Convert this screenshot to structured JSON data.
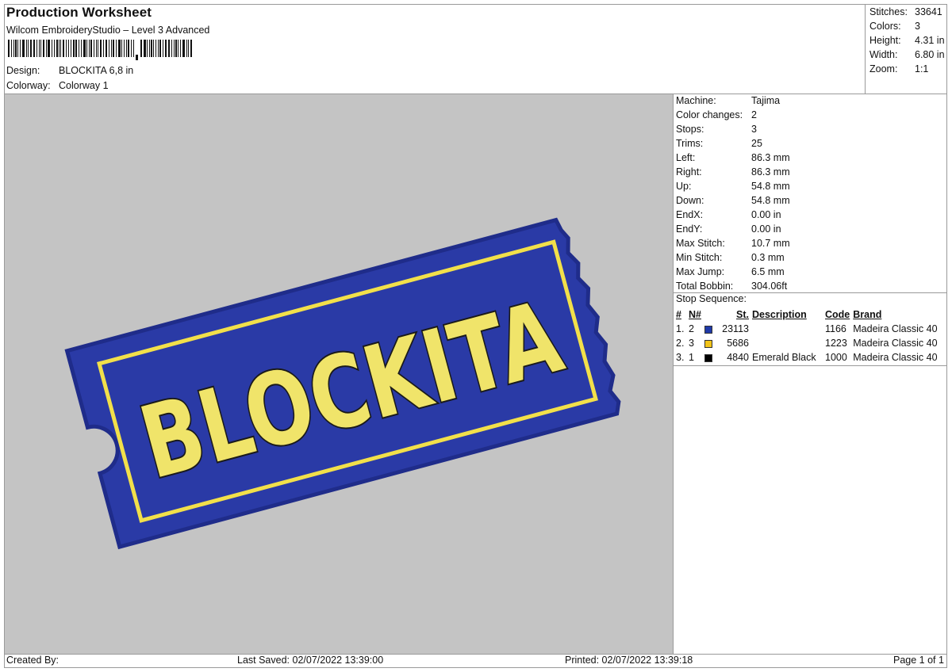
{
  "header": {
    "title": "Production Worksheet",
    "software": "Wilcom EmbroideryStudio – Level 3 Advanced",
    "design_label": "Design:",
    "design_value": "BLOCKITA 6,8 in",
    "colorway_label": "Colorway:",
    "colorway_value": "Colorway 1"
  },
  "summary": [
    {
      "label": "Stitches:",
      "value": "33641"
    },
    {
      "label": "Colors:",
      "value": "3"
    },
    {
      "label": "Height:",
      "value": "4.31 in"
    },
    {
      "label": "Width:",
      "value": "6.80 in"
    },
    {
      "label": "Zoom:",
      "value": "1:1"
    }
  ],
  "design_preview": {
    "text": "BLOCKITA",
    "colors": {
      "body": "#2a3aa6",
      "border": "#1f2c8a",
      "outline": "#f2e04a",
      "lettering": "#f0e46a",
      "letter_outline": "#1a1a1a"
    }
  },
  "machine_info": [
    {
      "label": "Machine:",
      "value": "Tajima"
    },
    {
      "label": "Color changes:",
      "value": "2"
    },
    {
      "label": "Stops:",
      "value": "3"
    },
    {
      "label": "Trims:",
      "value": "25"
    },
    {
      "label": "Left:",
      "value": "86.3 mm"
    },
    {
      "label": "Right:",
      "value": "86.3 mm"
    },
    {
      "label": "Up:",
      "value": "54.8 mm"
    },
    {
      "label": "Down:",
      "value": "54.8 mm"
    },
    {
      "label": "EndX:",
      "value": "0.00 in"
    },
    {
      "label": "EndY:",
      "value": "0.00 in"
    },
    {
      "label": "Max Stitch:",
      "value": "10.7 mm"
    },
    {
      "label": "Min Stitch:",
      "value": "0.3 mm"
    },
    {
      "label": "Max Jump:",
      "value": "6.5 mm"
    },
    {
      "label": "Total Bobbin:",
      "value": "304.06ft"
    }
  ],
  "stop_sequence": {
    "label": "Stop Sequence:",
    "columns": [
      "#",
      "N#",
      "St.",
      "Description",
      "Code",
      "Brand"
    ],
    "rows": [
      {
        "index": "1.",
        "n": "2",
        "color": "#1f3aa8",
        "stitches": "23113",
        "description": "",
        "code": "1166",
        "brand": "Madeira Classic 40"
      },
      {
        "index": "2.",
        "n": "3",
        "color": "#f2c418",
        "stitches": "5686",
        "description": "",
        "code": "1223",
        "brand": "Madeira Classic 40"
      },
      {
        "index": "3.",
        "n": "1",
        "color": "#000000",
        "stitches": "4840",
        "description": "Emerald Black",
        "code": "1000",
        "brand": "Madeira Classic 40"
      }
    ]
  },
  "footer": {
    "created_by": "Created By:",
    "last_saved": "Last Saved: 02/07/2022 13:39:00",
    "printed": "Printed: 02/07/2022 13:39:18",
    "page": "Page 1 of 1"
  }
}
